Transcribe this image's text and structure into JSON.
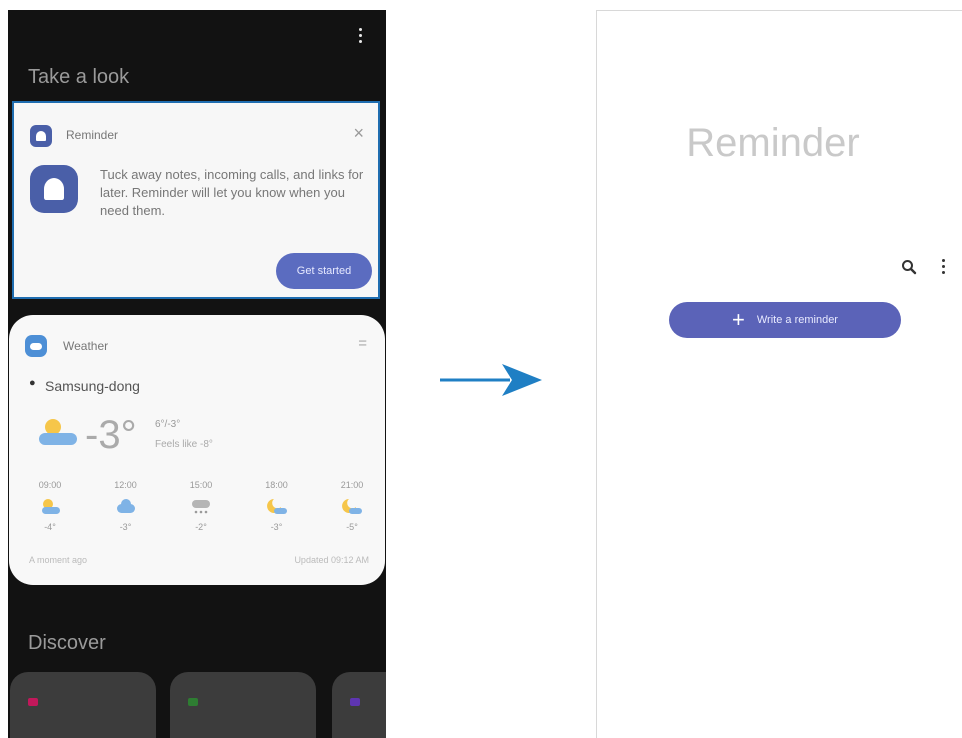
{
  "left_screen": {
    "section_take_a_look": "Take a look",
    "reminder_card": {
      "title": "Reminder",
      "close_glyph": "×",
      "description": "Tuck away notes, incoming calls, and links for later. Reminder will let you know when you need them.",
      "button_label": "Get started"
    },
    "weather_card": {
      "title": "Weather",
      "menu_glyph": "=",
      "location": "Samsung-dong",
      "temperature": "-3°",
      "range": "6°/-3°",
      "feels": "Feels like -8°",
      "hourly": [
        {
          "time": "09:00",
          "icon": "sun-cloud-icon",
          "temp": "-4°"
        },
        {
          "time": "12:00",
          "icon": "cloud-icon",
          "temp": "-3°"
        },
        {
          "time": "15:00",
          "icon": "snow-cloud-icon",
          "temp": "-2°"
        },
        {
          "time": "18:00",
          "icon": "moon-cloud-icon",
          "temp": "-3°"
        },
        {
          "time": "21:00",
          "icon": "moon-cloud-icon",
          "temp": "-5°"
        }
      ],
      "footer_left": "A moment ago",
      "footer_right": "Updated 09:12 AM"
    },
    "section_discover": "Discover",
    "discover_tiles": [
      {
        "icon": "tile-icon",
        "color": "#c2185b"
      },
      {
        "icon": "tile-icon",
        "color": "#2e7d32"
      },
      {
        "icon": "tile-icon",
        "color": "#5e35b1"
      }
    ]
  },
  "right_screen": {
    "title": "Reminder",
    "write_button_label": "Write a reminder",
    "write_button_plus": "+"
  },
  "colors": {
    "accent_blue": "#1f6db0",
    "reminder_purple": "#4a5fa8",
    "button_purple": "#5b63b8",
    "dark_bg": "#121212"
  }
}
